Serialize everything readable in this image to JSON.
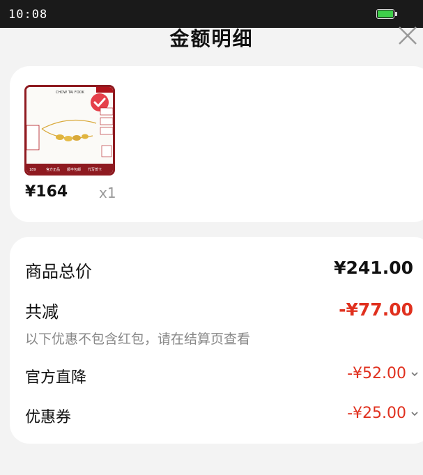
{
  "status_bar": {
    "time": "10:08",
    "battery_color": "#3ecf4a"
  },
  "sheet": {
    "title": "金额明细",
    "close_icon": "close-icon"
  },
  "product": {
    "image_brand_text": "CHOW TAI FOOK",
    "image_tag_price": "189",
    "image_tags": [
      "官方正品",
      "顺丰包邮",
      "代写贺卡"
    ],
    "price": "¥164",
    "quantity": "x1"
  },
  "summary": {
    "total_label": "商品总价",
    "total_value": "¥241.00",
    "reduce_label": "共减",
    "reduce_value": "-¥77.00",
    "note": "以下优惠不包含红包，请在结算页查看",
    "official_label": "官方直降",
    "official_value": "-¥52.00",
    "coupon_label": "优惠券",
    "coupon_value": "-¥25.00"
  },
  "colors": {
    "accent_red": "#e0301e",
    "background": "#f3f3f3",
    "card": "#ffffff"
  }
}
